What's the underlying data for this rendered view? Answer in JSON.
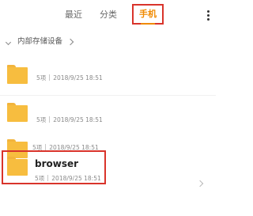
{
  "tabs": {
    "recent": "最近",
    "category": "分类",
    "phone": "手机"
  },
  "breadcrumb": {
    "label": "内部存储设备"
  },
  "items": [
    {
      "name": "",
      "count": "5项",
      "date": "2018/9/25 18:51"
    },
    {
      "name": "",
      "count": "5项",
      "date": "2018/9/25 18:51"
    },
    {
      "name": "",
      "count": "5项",
      "date": "2018/9/25 18:51"
    },
    {
      "name": "browser",
      "count": "5项",
      "date": "2018/9/25 18:51"
    }
  ],
  "colors": {
    "accent": "#f08a00",
    "highlight_border": "#d9342b",
    "folder": "#f7bd3f"
  },
  "icons": [
    "more-vertical-icon",
    "chevron-down-icon",
    "chevron-right-icon",
    "folder-icon"
  ]
}
